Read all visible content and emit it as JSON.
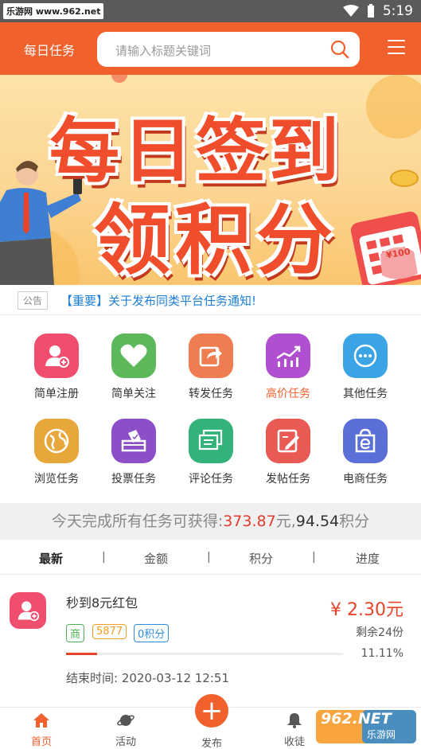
{
  "status_bar": {
    "watermark": "乐游网 www.962.net",
    "time": "5:19"
  },
  "header": {
    "title": "每日任务",
    "search_placeholder": "请输入标题关键词"
  },
  "banner": {
    "line1": "每日签到",
    "line2": "领积分",
    "coupon": "¥100"
  },
  "notice": {
    "tag": "公告",
    "text": "【重要】关于发布同类平台任务通知!"
  },
  "categories": [
    {
      "label": "简单注册",
      "color": "#f04e6e",
      "icon": "user-add-icon"
    },
    {
      "label": "简单关注",
      "color": "#5db85c",
      "icon": "heart-icon"
    },
    {
      "label": "转发任务",
      "color": "#ef7d52",
      "icon": "share-icon"
    },
    {
      "label": "高价任务",
      "color": "#b04fcf",
      "icon": "trend-up-icon",
      "highlight": true
    },
    {
      "label": "其他任务",
      "color": "#3aa4e4",
      "icon": "more-icon"
    },
    {
      "label": "浏览任务",
      "color": "#e8a73a",
      "icon": "globe-icon"
    },
    {
      "label": "投票任务",
      "color": "#8c4fc7",
      "icon": "vote-icon"
    },
    {
      "label": "评论任务",
      "color": "#33b37a",
      "icon": "comment-icon"
    },
    {
      "label": "发帖任务",
      "color": "#e95a55",
      "icon": "edit-icon"
    },
    {
      "label": "电商任务",
      "color": "#5b6fd8",
      "icon": "shopping-bag-icon"
    }
  ],
  "summary": {
    "prefix": "今天完成所有任务可获得:",
    "amount": "373.87",
    "unit1": "元,",
    "points": "94.54",
    "unit2": "积分"
  },
  "tabs": [
    "最新",
    "金额",
    "积分",
    "进度"
  ],
  "task": {
    "title": "秒到8元红包",
    "badges": [
      "商",
      "5877",
      "0积分"
    ],
    "price": "¥ 2.30元",
    "remaining": "剩余24份",
    "progress_pct": 11.11,
    "progress_label": "11.11%",
    "end_time": "结束时间: 2020-03-12 12:51"
  },
  "bottom_nav": {
    "home": "首页",
    "activity": "活动",
    "publish": "发布",
    "collect": "收徒"
  },
  "watermark_logo": {
    "top": "962.NET",
    "bottom": "乐游网"
  },
  "colors": {
    "brand": "#f0612e",
    "price": "#e8442a",
    "link": "#1e7fd9"
  }
}
